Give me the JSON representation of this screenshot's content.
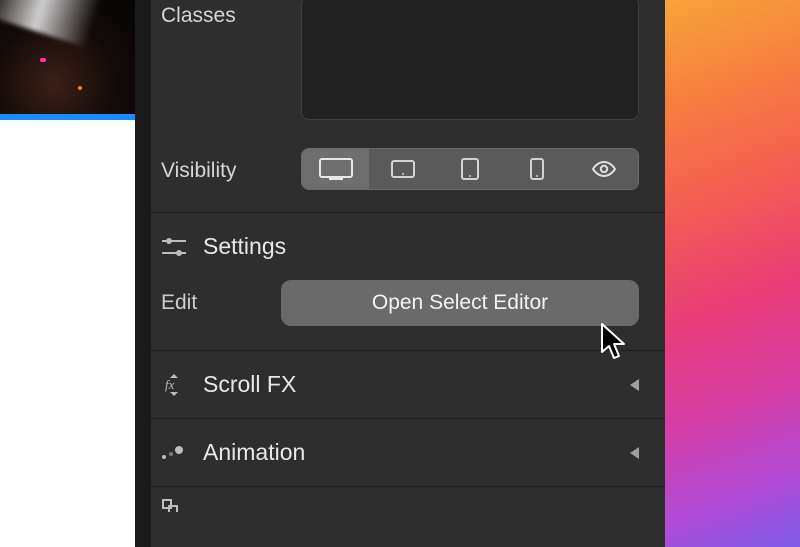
{
  "props": {
    "classes_label": "Classes",
    "classes_value": "",
    "visibility_label": "Visibility"
  },
  "visibility_options": [
    {
      "name": "desktop",
      "active": true
    },
    {
      "name": "tablet-landscape",
      "active": false
    },
    {
      "name": "tablet-portrait",
      "active": false
    },
    {
      "name": "phone",
      "active": false
    },
    {
      "name": "preview",
      "active": false
    }
  ],
  "settings": {
    "title": "Settings",
    "edit_label": "Edit",
    "open_button": "Open Select Editor"
  },
  "sections": {
    "scrollfx": "Scroll FX",
    "animation": "Animation"
  }
}
